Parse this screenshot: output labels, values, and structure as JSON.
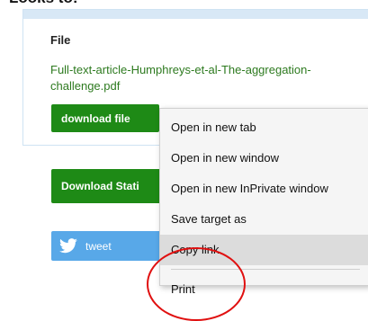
{
  "page": {
    "heading": "Looks to:"
  },
  "file_card": {
    "label": "File",
    "filename": "Full-text-article-Humphreys-et-al-The-aggregation-challenge.pdf",
    "download_label": "download file"
  },
  "buttons": {
    "download_stats": "Download Stati",
    "tweet": "tweet"
  },
  "context_menu": {
    "items": [
      {
        "label": "Open in new tab"
      },
      {
        "label": "Open in new window"
      },
      {
        "label": "Open in new InPrivate window"
      },
      {
        "label": "Save target as"
      },
      {
        "label": "Copy link"
      },
      {
        "label": "Print"
      }
    ],
    "highlighted": "Copy link"
  },
  "colors": {
    "accent_green": "#1e8a16",
    "link_green": "#2d7a1f",
    "twitter_blue": "#58a8e8",
    "annotation_red": "#e01010"
  }
}
